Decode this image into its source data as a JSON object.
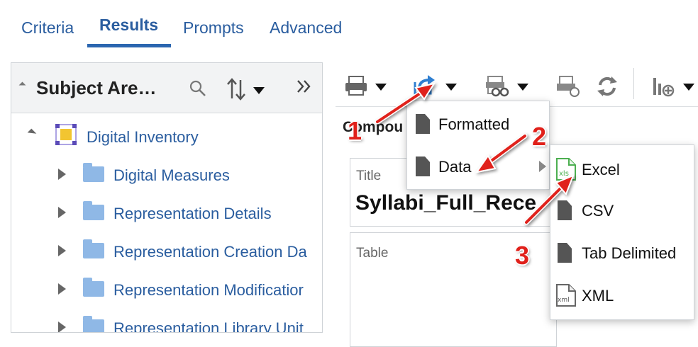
{
  "tabs": [
    {
      "label": "Criteria"
    },
    {
      "label": "Results"
    },
    {
      "label": "Prompts"
    },
    {
      "label": "Advanced"
    }
  ],
  "left_panel": {
    "title": "Subject Are…",
    "tree": {
      "root": {
        "label": "Digital Inventory"
      },
      "children": [
        {
          "label": "Digital Measures"
        },
        {
          "label": "Representation Details"
        },
        {
          "label": "Representation Creation Da"
        },
        {
          "label": "Representation Modificatior"
        },
        {
          "label": "Representation Library Unit"
        }
      ]
    }
  },
  "main": {
    "compound_label": "Compou",
    "title_view": {
      "label": "Title",
      "value": "Syllabi_Full_Rece"
    },
    "table_view": {
      "label": "Table"
    }
  },
  "export_menu": {
    "items": [
      {
        "label": "Formatted"
      },
      {
        "label": "Data"
      }
    ]
  },
  "data_submenu": {
    "items": [
      {
        "label": "Excel"
      },
      {
        "label": "CSV"
      },
      {
        "label": "Tab Delimited"
      },
      {
        "label": "XML"
      }
    ]
  },
  "annotations": {
    "steps": [
      "1",
      "2",
      "3"
    ],
    "color": "#e0201a"
  },
  "colors": {
    "link_blue": "#2a5d9f",
    "tab_underline": "#2b66b0",
    "export_icon_blue": "#2f7fd1",
    "folder_blue": "#8fb8e6"
  }
}
